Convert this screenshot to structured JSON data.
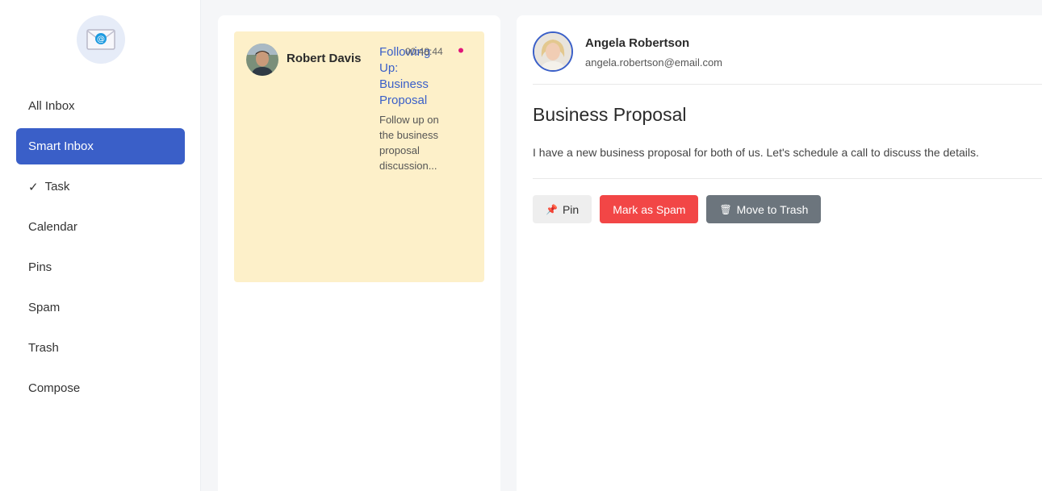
{
  "sidebar": {
    "logo_icon": "envelope-at-icon",
    "items": [
      {
        "label": "All Inbox"
      },
      {
        "label": "Smart Inbox",
        "active": true
      },
      {
        "label": "Task",
        "check": "✓"
      },
      {
        "label": "Calendar"
      },
      {
        "label": "Pins"
      },
      {
        "label": "Spam"
      },
      {
        "label": "Trash"
      },
      {
        "label": "Compose"
      }
    ]
  },
  "mail_list": {
    "cards": [
      {
        "sender": "Robert Davis",
        "subject": "Following Up: Business Proposal",
        "time": "00:48:44",
        "preview": "Follow up on the business proposal discussion...",
        "pinned_color": "#e0167a"
      }
    ]
  },
  "detail": {
    "sender_name": "Angela Robertson",
    "sender_email": "angela.robertson@email.com",
    "subject": "Business Proposal",
    "body": "I have a new business proposal for both of us. Let's schedule a call to discuss the details.",
    "actions": {
      "pin_icon": "📌",
      "pin_label": "Pin",
      "spam_label": "Mark as Spam",
      "trash_icon": "🗑",
      "trash_label": "Move to Trash"
    }
  },
  "colors": {
    "accent": "#3a5fc8",
    "card_bg": "#fdf0c9",
    "spam": "#f24646",
    "trash": "#6c757d"
  }
}
